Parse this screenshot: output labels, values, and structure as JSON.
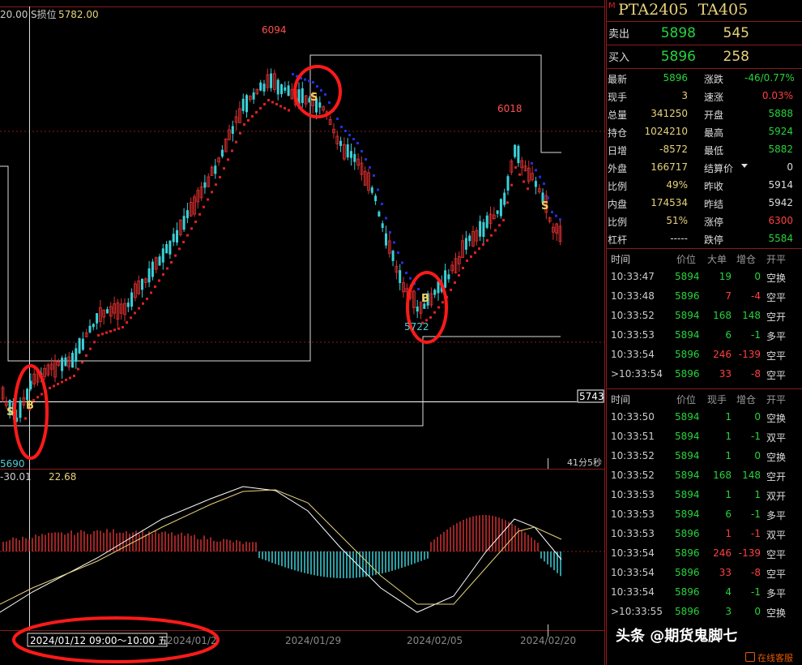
{
  "chart": {
    "top_left_value": "20.00",
    "stop_loss_label": "S损位",
    "stop_loss_value": "5782.00",
    "high_label": "6094",
    "high2_label": "6018",
    "low_label": "5690",
    "low2_label": "5722",
    "right_price_tag": "5743",
    "countdown": "41分5秒",
    "signal_s": "S",
    "signal_b": "B",
    "macd_left": "-30.01",
    "macd_right": "22.68",
    "date_labels": [
      "2024/01/12 09:00～10:00 五",
      "2024/01/2",
      "2024/01/29",
      "2024/02/05",
      "2024/02/20"
    ]
  },
  "quote": {
    "m_badge": "M",
    "symbol": "PTA2405  TA405",
    "sell": {
      "label": "卖出",
      "price": "5898",
      "volume": "545"
    },
    "buy": {
      "label": "买入",
      "price": "5896",
      "volume": "258"
    },
    "stats": [
      {
        "l1": "最新",
        "v1": "5896",
        "c1": "g",
        "l2": "涨跌",
        "v2": "-46/0.77%",
        "c2": "g"
      },
      {
        "l1": "现手",
        "v1": "3",
        "c1": "y",
        "l2": "速涨",
        "v2": "0.03%",
        "c2": "r"
      },
      {
        "l1": "总量",
        "v1": "341250",
        "c1": "y",
        "l2": "开盘",
        "v2": "5888",
        "c2": "g"
      },
      {
        "l1": "持仓",
        "v1": "1024210",
        "c1": "y",
        "l2": "最高",
        "v2": "5924",
        "c2": "g"
      },
      {
        "l1": "日增",
        "v1": "-8572",
        "c1": "y",
        "l2": "最低",
        "v2": "5882",
        "c2": "g"
      },
      {
        "l1": "外盘",
        "v1": "166717",
        "c1": "y",
        "l2": "结算价",
        "v2": "0",
        "c2": "w"
      },
      {
        "l1": "比例",
        "v1": "49%",
        "c1": "y",
        "l2": "昨收",
        "v2": "5914",
        "c2": "w"
      },
      {
        "l1": "内盘",
        "v1": "174534",
        "c1": "y",
        "l2": "昨结",
        "v2": "5942",
        "c2": "w"
      },
      {
        "l1": "比例",
        "v1": "51%",
        "c1": "y",
        "l2": "涨停",
        "v2": "6300",
        "c2": "r"
      },
      {
        "l1": "杠杆",
        "v1": "-----",
        "c1": "w",
        "l2": "跌停",
        "v2": "5584",
        "c2": "g"
      }
    ],
    "table1": {
      "headers": [
        "时间",
        "价位",
        "大单",
        "增仓",
        "开平"
      ],
      "rows": [
        {
          "time": "10:33:47",
          "price": "5894",
          "pc": "g",
          "vol": "19",
          "vc": "g",
          "oi": "0",
          "type": "空换"
        },
        {
          "time": "10:33:48",
          "price": "5896",
          "pc": "g",
          "vol": "7",
          "vc": "r",
          "oi": "-4",
          "type": "空平"
        },
        {
          "time": "10:33:52",
          "price": "5894",
          "pc": "g",
          "vol": "168",
          "vc": "g",
          "oi": "148",
          "type": "空开"
        },
        {
          "time": "10:33:53",
          "price": "5894",
          "pc": "g",
          "vol": "6",
          "vc": "g",
          "oi": "-1",
          "type": "多平"
        },
        {
          "time": "10:33:54",
          "price": "5896",
          "pc": "g",
          "vol": "246",
          "vc": "r",
          "oi": "-139",
          "type": "空平"
        },
        {
          "time": ">10:33:54",
          "price": "5896",
          "pc": "g",
          "vol": "33",
          "vc": "r",
          "oi": "-8",
          "type": "空平"
        }
      ]
    },
    "table2": {
      "headers": [
        "时间",
        "价位",
        "现手",
        "增仓",
        "开平"
      ],
      "rows": [
        {
          "time": "10:33:50",
          "price": "5894",
          "pc": "g",
          "vol": "1",
          "vc": "g",
          "oi": "0",
          "type": "空换"
        },
        {
          "time": "10:33:51",
          "price": "5894",
          "pc": "g",
          "vol": "1",
          "vc": "g",
          "oi": "-1",
          "type": "双平"
        },
        {
          "time": "10:33:52",
          "price": "5894",
          "pc": "g",
          "vol": "1",
          "vc": "g",
          "oi": "0",
          "type": "空换"
        },
        {
          "time": "10:33:52",
          "price": "5894",
          "pc": "g",
          "vol": "168",
          "vc": "g",
          "oi": "148",
          "type": "空开"
        },
        {
          "time": "10:33:53",
          "price": "5894",
          "pc": "g",
          "vol": "1",
          "vc": "g",
          "oi": "1",
          "type": "双开"
        },
        {
          "time": "10:33:53",
          "price": "5894",
          "pc": "g",
          "vol": "6",
          "vc": "g",
          "oi": "-1",
          "type": "多平"
        },
        {
          "time": "10:33:53",
          "price": "5896",
          "pc": "g",
          "vol": "1",
          "vc": "r",
          "oi": "-1",
          "type": "双平"
        },
        {
          "time": "10:33:54",
          "price": "5896",
          "pc": "g",
          "vol": "246",
          "vc": "r",
          "oi": "-139",
          "type": "空平"
        },
        {
          "time": "10:33:54",
          "price": "5896",
          "pc": "g",
          "vol": "33",
          "vc": "r",
          "oi": "-8",
          "type": "空平"
        },
        {
          "time": "10:33:54",
          "price": "5896",
          "pc": "g",
          "vol": "4",
          "vc": "g",
          "oi": "-1",
          "type": "多平"
        },
        {
          "time": ">10:33:55",
          "price": "5896",
          "pc": "g",
          "vol": "3",
          "vc": "g",
          "oi": "0",
          "type": "空换"
        }
      ]
    },
    "watermark": "头条 @期货鬼脚七",
    "online_service": "在线客服"
  }
}
